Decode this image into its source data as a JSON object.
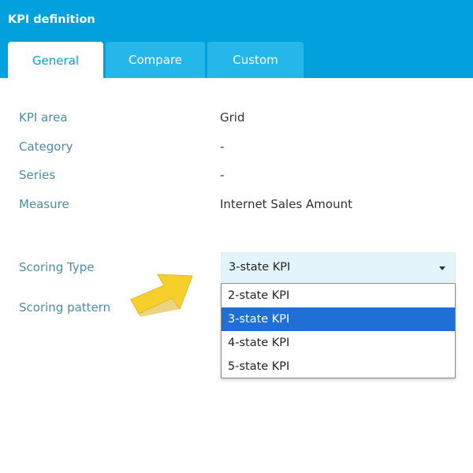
{
  "header": {
    "title": "KPI definition",
    "accent_color": "#02a1de"
  },
  "tabs": [
    {
      "label": "General",
      "active": true
    },
    {
      "label": "Compare",
      "active": false
    },
    {
      "label": "Custom",
      "active": false
    }
  ],
  "fields": {
    "kpi_area": {
      "label": "KPI area",
      "value": "Grid"
    },
    "category": {
      "label": "Category",
      "value": "-"
    },
    "series": {
      "label": "Series",
      "value": "-"
    },
    "measure": {
      "label": "Measure",
      "value": "Internet Sales Amount"
    }
  },
  "scoring_type": {
    "label": "Scoring Type",
    "selected": "3-state KPI",
    "options": [
      "2-state KPI",
      "3-state KPI",
      "4-state KPI",
      "5-state KPI"
    ],
    "highlight_color": "#1f6fd6"
  },
  "scoring_pattern": {
    "label": "Scoring pattern"
  },
  "annotation": {
    "icon": "arrow-pointer-icon",
    "color": "#f7cf2a"
  }
}
